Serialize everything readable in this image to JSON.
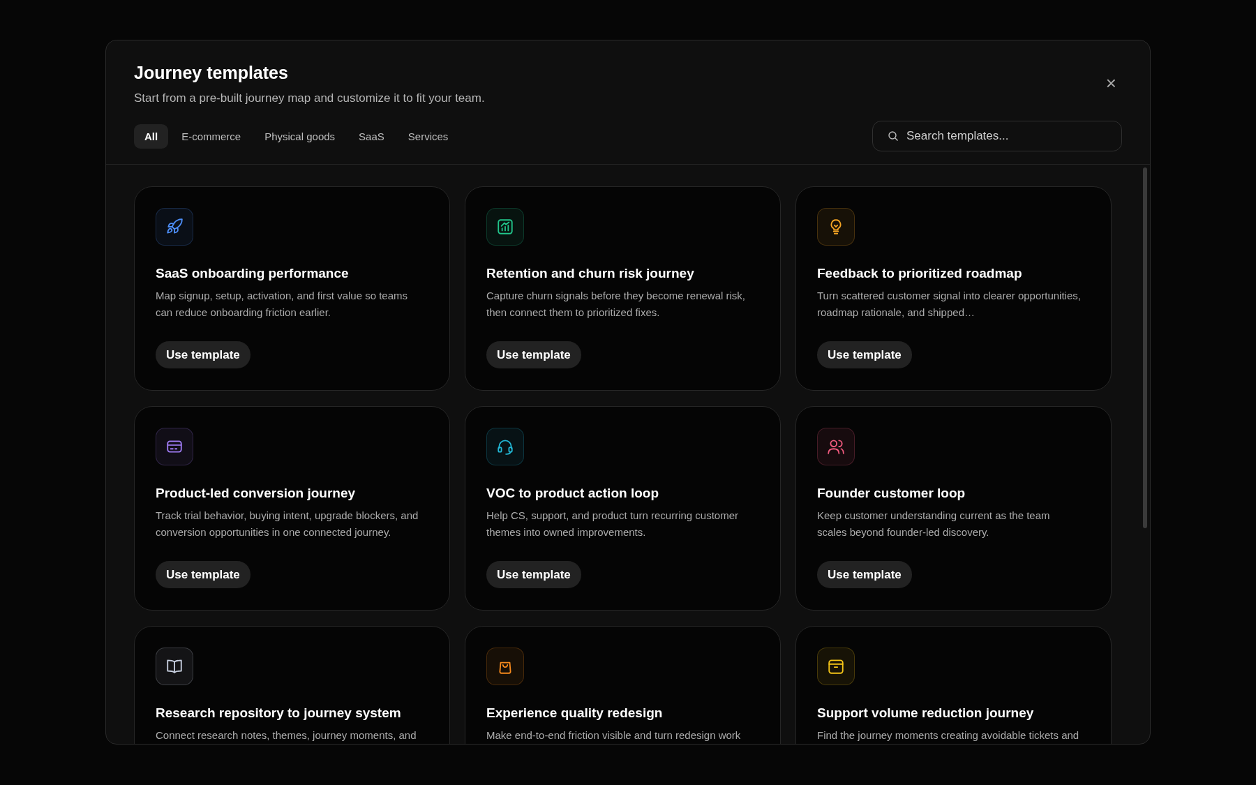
{
  "dialog": {
    "title": "Journey templates",
    "subtitle": "Start from a pre-built journey map and customize it to fit your team.",
    "close_label": "×"
  },
  "tabs": [
    {
      "label": "All",
      "selected": true
    },
    {
      "label": "E-commerce",
      "selected": false
    },
    {
      "label": "Physical goods",
      "selected": false
    },
    {
      "label": "SaaS",
      "selected": false
    },
    {
      "label": "Services",
      "selected": false
    }
  ],
  "search": {
    "placeholder": "Search templates..."
  },
  "templates": [
    {
      "title": "SaaS onboarding performance",
      "description": "Map signup, setup, activation, and first value so teams can reduce onboarding friction earlier.",
      "button": "Use template",
      "color": "#4d8ef7"
    },
    {
      "title": "Retention and churn risk journey",
      "description": "Capture churn signals before they become renewal risk, then connect them to prioritized fixes.",
      "button": "Use template",
      "color": "#22c58b"
    },
    {
      "title": "Feedback to prioritized roadmap",
      "description": "Turn scattered customer signal into clearer opportunities, roadmap rationale, and shipped…",
      "button": "Use template",
      "color": "#f5a524"
    },
    {
      "title": "Product-led conversion journey",
      "description": "Track trial behavior, buying intent, upgrade blockers, and conversion opportunities in one connected journey.",
      "button": "Use template",
      "color": "#a07cf5"
    },
    {
      "title": "VOC to product action loop",
      "description": "Help CS, support, and product turn recurring customer themes into owned improvements.",
      "button": "Use template",
      "color": "#22b8d6"
    },
    {
      "title": "Founder customer loop",
      "description": "Keep customer understanding current as the team scales beyond founder-led discovery.",
      "button": "Use template",
      "color": "#f05a7e"
    },
    {
      "title": "Research repository to journey system",
      "description": "Connect research notes, themes, journey moments, and",
      "color": "#c8d0e0"
    },
    {
      "title": "Experience quality redesign",
      "description": "Make end-to-end friction visible and turn redesign work",
      "color": "#f78a1d"
    },
    {
      "title": "Support volume reduction journey",
      "description": "Find the journey moments creating avoidable tickets and",
      "color": "#f5c518"
    }
  ]
}
